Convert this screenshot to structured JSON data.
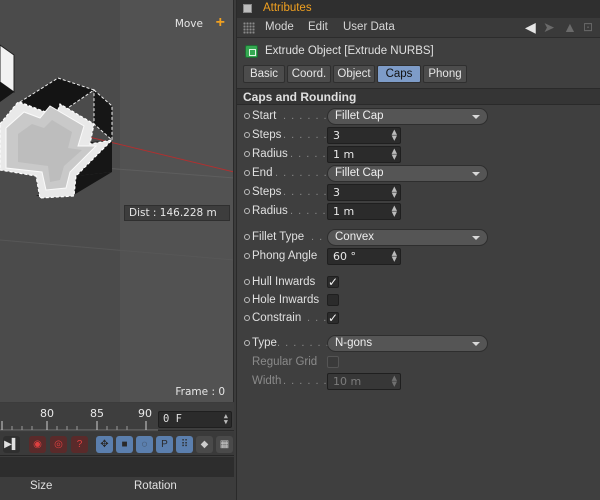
{
  "viewport": {
    "mode_label": "Move",
    "distance_label": "Dist : 146.228 m",
    "frame_label": "Frame : 0"
  },
  "timeline": {
    "ticks": [
      "80",
      "85",
      "90"
    ],
    "current_frame": "0 F"
  },
  "coordinates": {
    "size_header": "Size",
    "rotation_header": "Rotation"
  },
  "attributes": {
    "title": "Attributes",
    "menu": [
      "Mode",
      "Edit",
      "User Data"
    ],
    "object_name": "Extrude Object [Extrude NURBS]",
    "tabs": [
      "Basic",
      "Coord.",
      "Object",
      "Caps",
      "Phong"
    ],
    "active_tab": "Caps",
    "section_title": "Caps and Rounding",
    "params": {
      "start": {
        "label": "Start",
        "dots": ". . . . . .",
        "value": "Fillet Cap"
      },
      "steps1": {
        "label": "Steps",
        "dots": ". . . . . .",
        "value": "3"
      },
      "radius1": {
        "label": "Radius",
        "dots": ". . . . .",
        "value": "1 m"
      },
      "end": {
        "label": "End",
        "dots": ". . . . . . .",
        "value": "Fillet Cap"
      },
      "steps2": {
        "label": "Steps",
        "dots": ". . . . . .",
        "value": "3"
      },
      "radius2": {
        "label": "Radius",
        "dots": ". . . . .",
        "value": "1 m"
      },
      "fillet_type": {
        "label": "Fillet Type",
        "dots": ". .",
        "value": "Convex"
      },
      "phong_angle": {
        "label": "Phong Angle",
        "dots": "",
        "value": "60 °"
      },
      "hull_inwards": {
        "label": "Hull Inwards",
        "checked": true
      },
      "hole_inwards": {
        "label": "Hole Inwards",
        "checked": false
      },
      "constrain": {
        "label": "Constrain",
        "dots": ". . .",
        "checked": true
      },
      "type": {
        "label": "Type",
        "dots": ". . . . . . .",
        "value": "N-gons"
      },
      "regular_grid": {
        "label": "Regular Grid",
        "checked": false
      },
      "width": {
        "label": "Width",
        "dots": ". . . . . .",
        "value": "10 m"
      }
    }
  },
  "colors": {
    "accent_orange": "#f0a020",
    "active_tab": "#7e9cc8",
    "object_icon": "#35a852"
  }
}
